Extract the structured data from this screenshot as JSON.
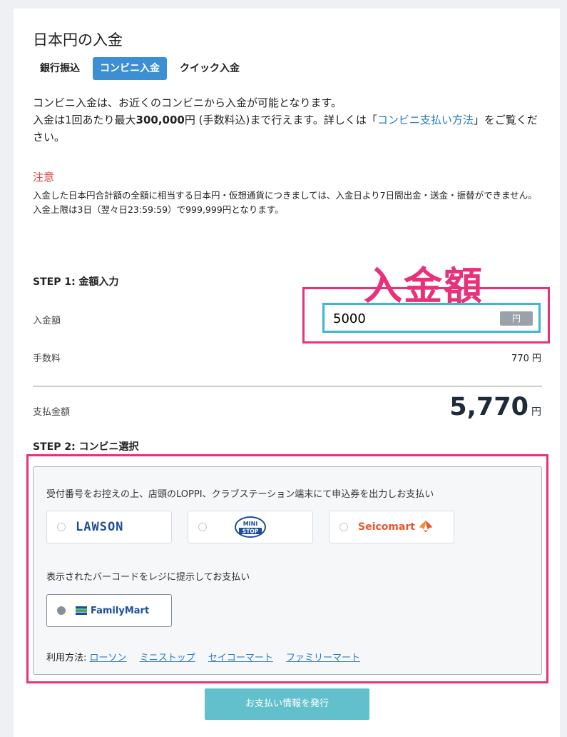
{
  "page_title": "日本円の入金",
  "tabs": [
    {
      "label": "銀行振込"
    },
    {
      "label": "コンビニ入金"
    },
    {
      "label": "クイック入金"
    }
  ],
  "desc": {
    "line1": "コンビニ入金は、お近くのコンビニから入金が可能となります。",
    "line2_pre": "入金は1回あたり最大",
    "line2_amount": "300,000",
    "line2_mid": "円 (手数料込)まで行えます。詳しくは「",
    "line2_link": "コンビニ支払い方法",
    "line2_post": "」をご覧ください。"
  },
  "notice": {
    "heading": "注意",
    "line1": "入金した日本円合計額の全額に相当する日本円・仮想通貨につきましては、入金日より7日間出金・送金・振替ができません。",
    "line2": "入金上限は3日（翌々日23:59:59）で999,999円となります。"
  },
  "step1": {
    "title": "STEP 1: 金額入力",
    "amount_label": "入金額",
    "amount_value": "5000",
    "amount_unit": "円",
    "fee_label": "手数料",
    "fee_value": "770 円",
    "total_label": "支払金額",
    "total_value": "5,770",
    "total_unit": "円"
  },
  "callout": "入金額",
  "step2": {
    "title": "STEP 2: コンビニ選択",
    "loppi_text": "受付番号をお控えの上、店頭のLOPPI、クラブステーション端末にて申込券を出力しお支払い",
    "barcode_text": "表示されたバーコードをレジに提示してお支払い",
    "stores": {
      "lawson": "LAWSON",
      "ministop_top": "MINI",
      "ministop_bottom": "STOP",
      "seicomart": "Seicomart",
      "familymart": "FamilyMart"
    },
    "usage_label": "利用方法:",
    "usage_links": [
      "ローソン",
      "ミニストップ",
      "セイコーマート",
      "ファミリーマート"
    ]
  },
  "issue_button": "お支払い情報を発行",
  "colors": {
    "accent": "#3d8fd4",
    "highlight": "#e8317a",
    "input_border": "#3bb8c9",
    "button": "#62c0cc"
  }
}
